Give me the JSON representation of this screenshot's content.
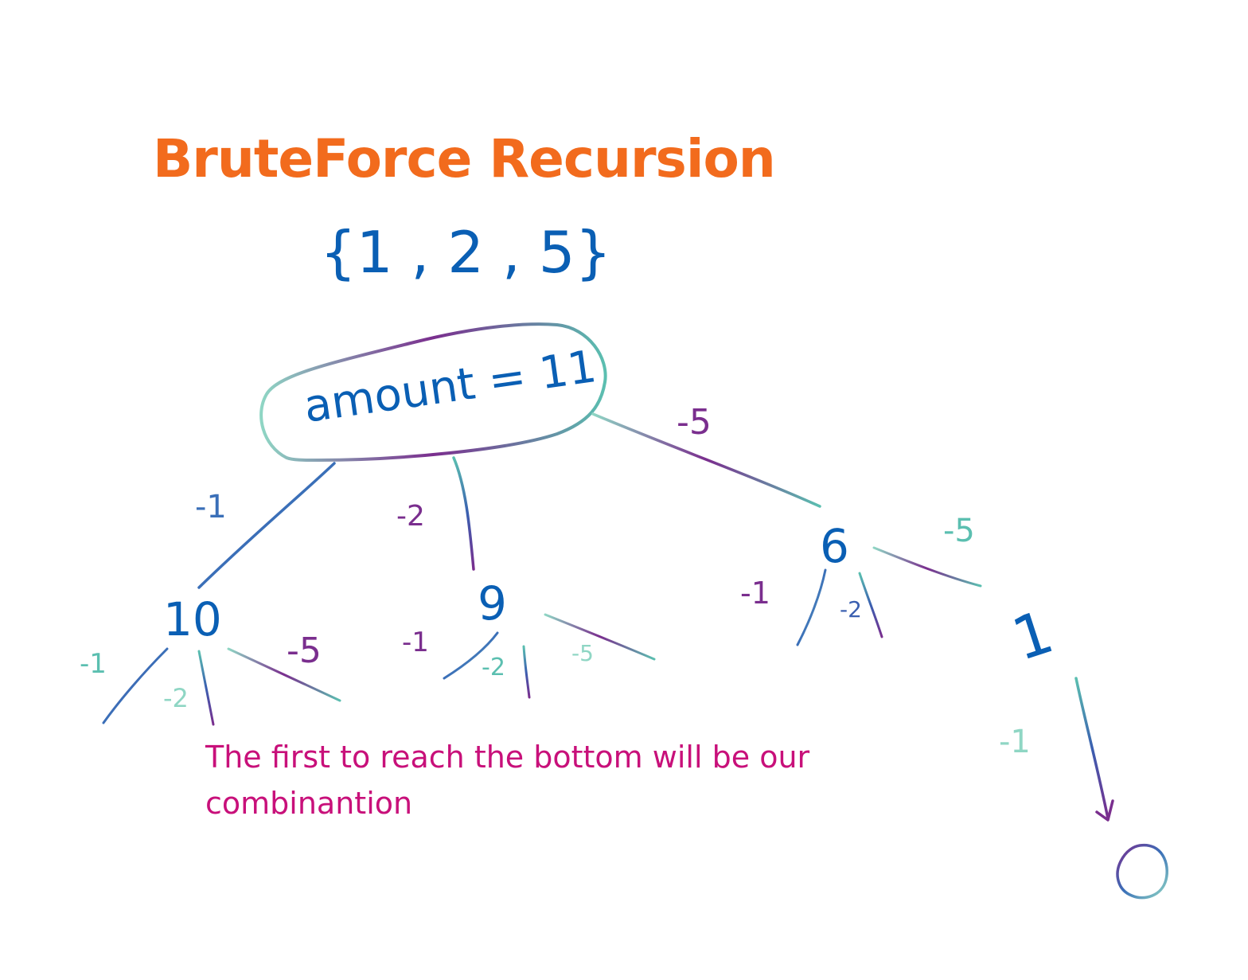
{
  "title": "BruteForce Recursion",
  "coin_set": "{1 , 2 , 5}",
  "root": {
    "label": "amount = 11"
  },
  "nodes": {
    "n10": "10",
    "n9": "9",
    "n6": "6",
    "n1": "1",
    "n0": "0"
  },
  "edge_labels": {
    "root_to_10": "-1",
    "root_to_9": "-2",
    "root_to_6": "-5",
    "from10_a": "-1",
    "from10_b": "-2",
    "from10_c": "-5",
    "from9_a": "-1",
    "from9_b": "-2",
    "from9_c": "-5",
    "from6_a": "-1",
    "from6_b": "-2",
    "from6_c": "-5",
    "from1_a": "-1"
  },
  "note": "The first to reach the bottom will be our combinantion",
  "colors": {
    "title": "#f26b1d",
    "ink_blue": "#0a5fb4",
    "note": "#c8107a",
    "line_purple": "#7a2e8e",
    "line_teal": "#5bbfb0",
    "line_blue": "#3a5fb0"
  }
}
